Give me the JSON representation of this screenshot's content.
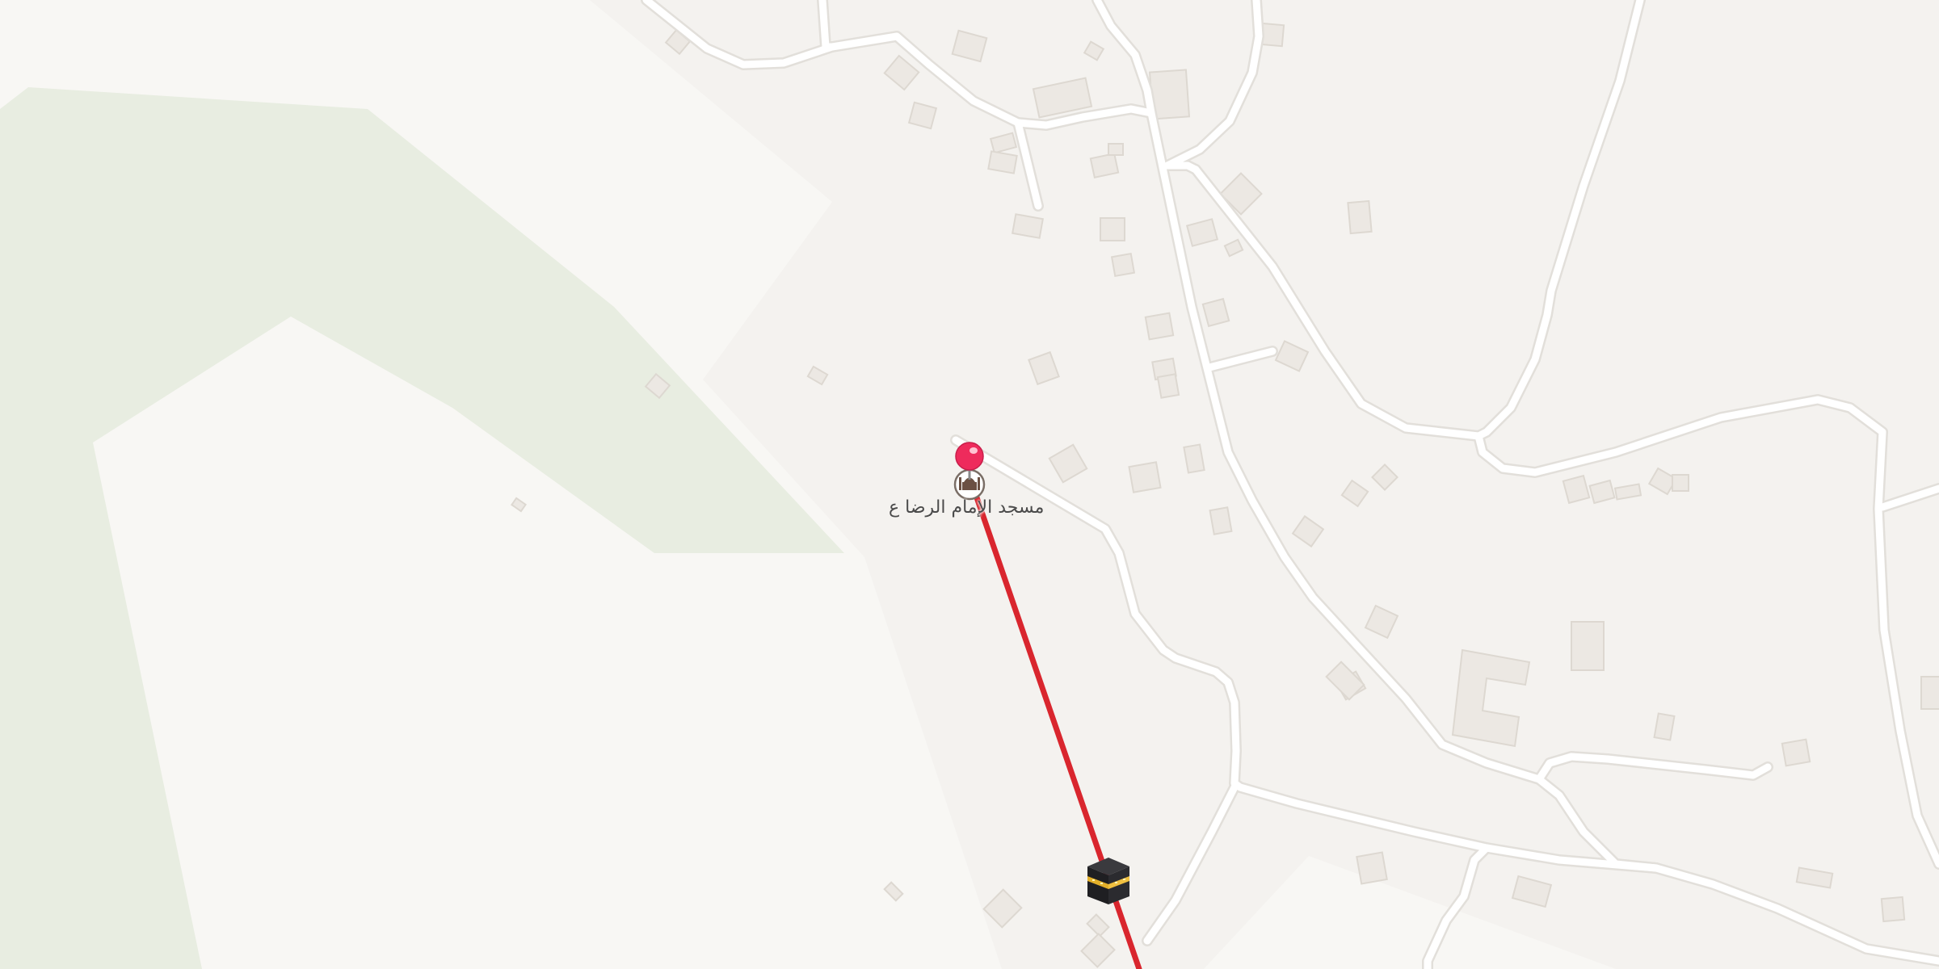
{
  "map": {
    "colors": {
      "background": "#f4f2ef",
      "light_area": "#f8f7f4",
      "park": "#e8ede1",
      "road": "#ffffff",
      "road_casing": "#e2dfda",
      "building": "#ece8e3",
      "building_shadow": "#ddd8d1",
      "route_line": "#d9262e",
      "pin": "#ee2b5c"
    },
    "places": [
      {
        "name": "مسجد الإمام الرضا ع",
        "type": "mosque",
        "icon": "mosque-icon",
        "selected": true
      }
    ],
    "markers": [
      {
        "type": "location-pin",
        "icon": "pin-icon"
      },
      {
        "type": "destination",
        "icon": "kaaba-icon"
      }
    ],
    "route": {
      "kind": "qibla-direction-line",
      "color": "#d9262e"
    }
  }
}
